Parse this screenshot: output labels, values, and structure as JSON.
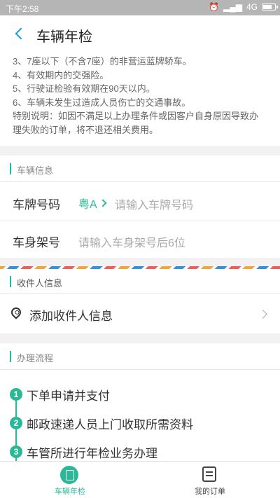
{
  "status_bar": {
    "time": "下午2:58",
    "network": "4G"
  },
  "header": {
    "title": "车辆年检"
  },
  "notes": [
    "3、7座以下（不含7座）的非营运蓝牌轿车。",
    "4、有效期内的交强险。",
    "5、行驶证检验有效期在90天以内。",
    "6、车辆未发生过造成人员伤亡的交通事故。",
    "特别说明：如因不满足以上办理条件或因客户自身原因导致办",
    "理失败的订单，将不退还相关费用。"
  ],
  "vehicle": {
    "section_title": "车辆信息",
    "plate_label": "车牌号码",
    "plate_prefix": "粤A",
    "plate_placeholder": "请输入车牌号码",
    "vin_label": "车身架号",
    "vin_placeholder": "请输入车身架号后6位"
  },
  "recipient": {
    "section_title": "收件人信息",
    "add_label": "添加收件人信息"
  },
  "process": {
    "section_title": "办理流程",
    "steps": [
      {
        "num": "1",
        "text": "下单申请并支付"
      },
      {
        "num": "2",
        "text": "邮政速递人员上门收取所需资料"
      },
      {
        "num": "3",
        "text": "车管所进行年检业务办理"
      }
    ]
  },
  "tabbar": {
    "tab1": "车辆年检",
    "tab2": "我的订单"
  },
  "colors": {
    "accent": "#2ab899",
    "back": "#1a9be6"
  },
  "battery_level": 0.8
}
